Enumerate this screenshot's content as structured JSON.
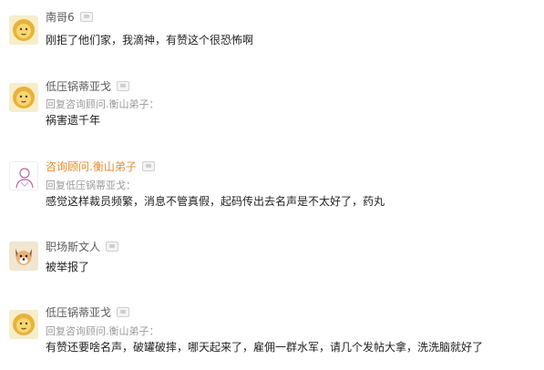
{
  "comments": [
    {
      "avatar_icon": "lion-avatar-icon",
      "author": "南哥6",
      "reply_to": "",
      "text": "刚拒了他们家，我滴神，有赞这个很恐怖啊"
    },
    {
      "avatar_icon": "lion-avatar-icon",
      "author": "低压锅蒂亚戈",
      "reply_to": "回复咨询顾问.衡山弟子：",
      "text": "祸害遗千年"
    },
    {
      "avatar_icon": "sketch-person-avatar-icon",
      "author": "咨询顾问.衡山弟子",
      "author_color": "#e88b2a",
      "reply_to": "回复低压锅蒂亚戈：",
      "text": "感觉这样裁员频繁，消息不管真假，起码传出去名声是不太好了，药丸"
    },
    {
      "avatar_icon": "dog-avatar-icon",
      "author": "职场斯文人",
      "reply_to": "",
      "text": "被举报了"
    },
    {
      "avatar_icon": "lion-avatar-icon",
      "author": "低压锅蒂亚戈",
      "reply_to": "回复咨询顾问.衡山弟子：",
      "text": "有赞还要啥名声，破罐破摔，哪天起来了，雇佣一群水军，请几个发帖大拿，洗洗脑就好了"
    }
  ]
}
